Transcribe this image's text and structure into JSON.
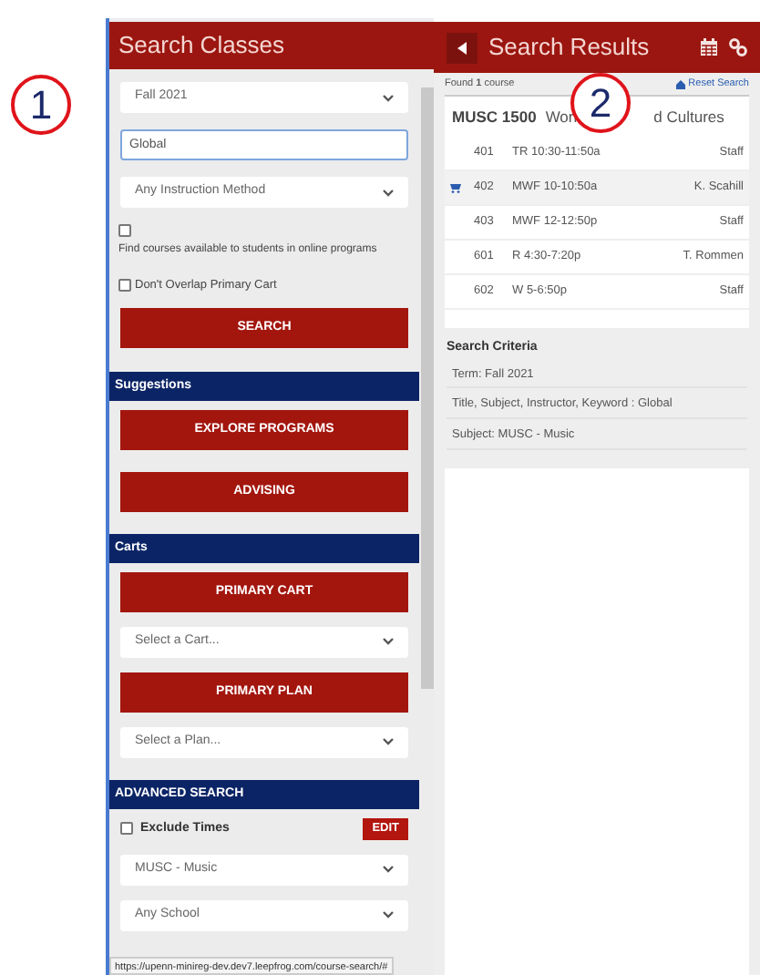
{
  "callouts": [
    {
      "label": "1"
    },
    {
      "label": "2"
    }
  ],
  "search_panel": {
    "title": "Search Classes",
    "term": {
      "value": "Fall 2021"
    },
    "keyword": {
      "value": "Global"
    },
    "instruction_method": {
      "value": "Any Instruction Method"
    },
    "online_programs": {
      "label": "Find courses available to students in online programs",
      "checked": false
    },
    "no_overlap": {
      "label": "Don't Overlap Primary Cart",
      "checked": false
    },
    "search_button": "SEARCH",
    "sections": [
      {
        "title": "Suggestions",
        "items": [
          {
            "kind": "button",
            "label": "EXPLORE PROGRAMS"
          },
          {
            "kind": "button",
            "label": "ADVISING"
          }
        ]
      },
      {
        "title": "Carts",
        "items": [
          {
            "kind": "button",
            "label": "PRIMARY CART"
          },
          {
            "kind": "select",
            "label": "Select a Cart..."
          },
          {
            "kind": "button",
            "label": "PRIMARY PLAN"
          },
          {
            "kind": "select",
            "label": "Select a Plan..."
          }
        ]
      },
      {
        "title": "ADVANCED SEARCH",
        "items": [
          {
            "kind": "checkbox",
            "label": "Exclude Times",
            "checked": false,
            "action": "EDIT"
          },
          {
            "kind": "select",
            "label": "MUSC - Music"
          },
          {
            "kind": "select",
            "label": "Any School"
          }
        ]
      }
    ],
    "status_url": "https://upenn-minireg-dev.dev7.leepfrog.com/course-search/#"
  },
  "results_panel": {
    "title": "Search Results",
    "found": "Found **1** course",
    "reset": "Reset Search",
    "course": {
      "code": "MUSC 1500",
      "title_start": "Worl",
      "title_end": "d Cultures"
    },
    "rows": [
      {
        "section": "401",
        "time": "TR 10:30-11:50a",
        "instructor": "Staff",
        "in_cart": false,
        "highlighted": false
      },
      {
        "section": "402",
        "time": "MWF 10-10:50a",
        "instructor": "K. Scahill",
        "in_cart": true,
        "highlighted": true
      },
      {
        "section": "403",
        "time": "MWF 12-12:50p",
        "instructor": "Staff",
        "in_cart": false,
        "highlighted": false
      },
      {
        "section": "601",
        "time": "R 4:30-7:20p",
        "instructor": "T. Rommen",
        "in_cart": false,
        "highlighted": false
      },
      {
        "section": "602",
        "time": "W 5-6:50p",
        "instructor": "Staff",
        "in_cart": false,
        "highlighted": false
      }
    ],
    "criteria": {
      "title": "Search Criteria",
      "lines": [
        "Term: Fall 2021",
        "Title, Subject, Instructor, Keyword : Global",
        "Subject: MUSC - Music"
      ]
    }
  }
}
